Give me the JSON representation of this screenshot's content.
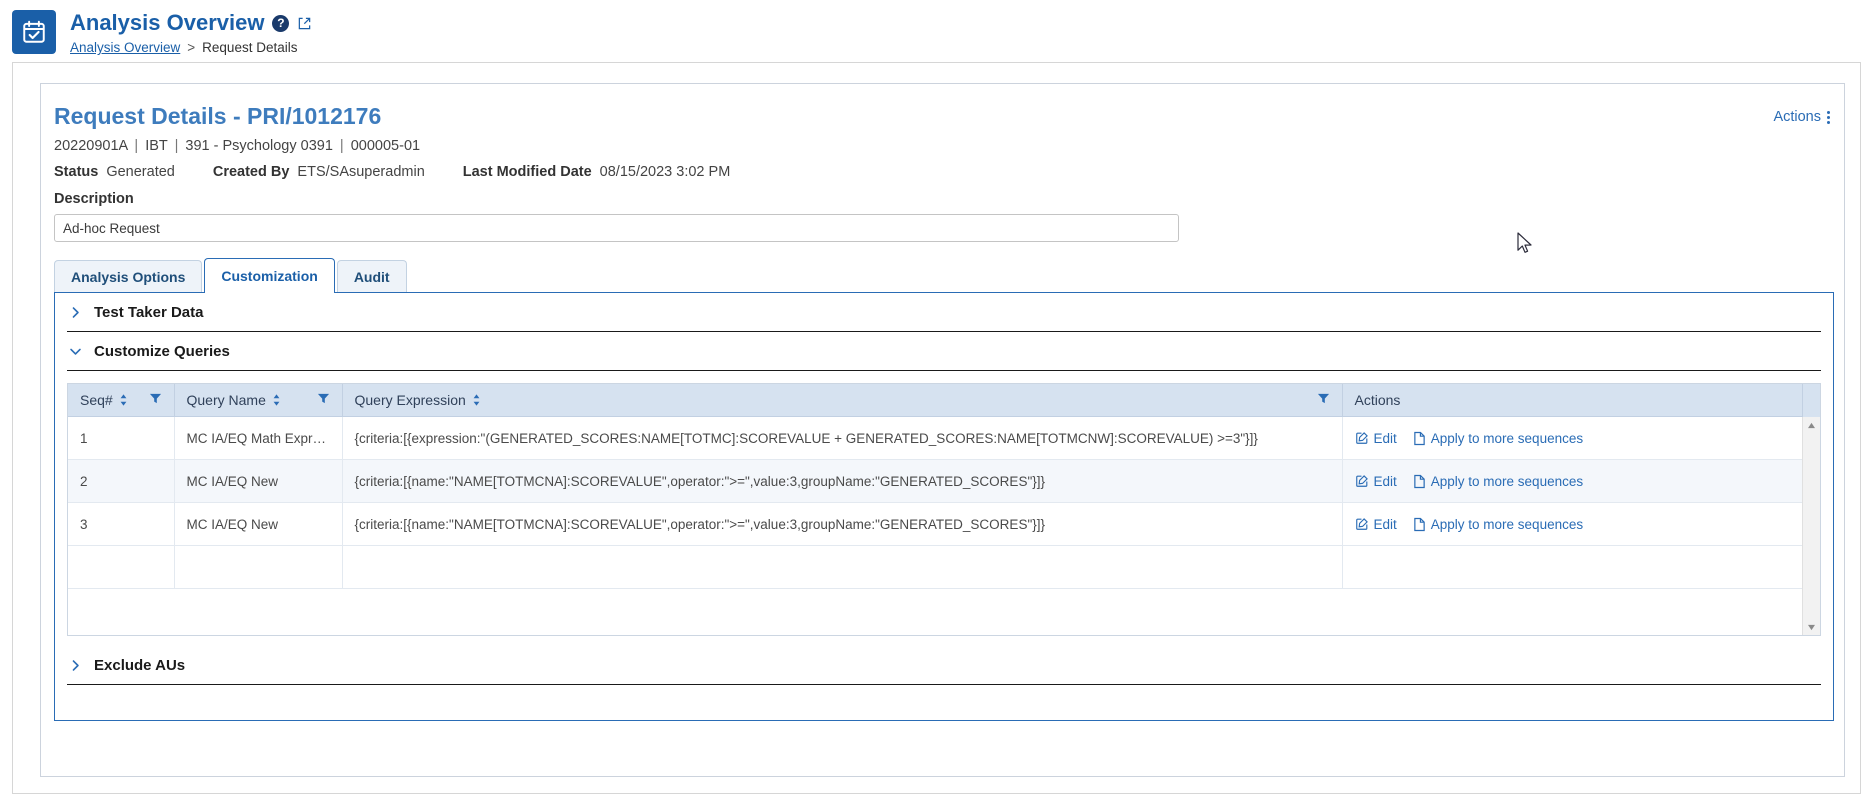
{
  "header": {
    "app_icon": "calendar-check-icon",
    "title": "Analysis Overview",
    "help_icon": "?",
    "external_link_icon": "external-link-icon",
    "breadcrumb": {
      "root": "Analysis Overview",
      "separator": ">",
      "current": "Request Details"
    }
  },
  "card": {
    "title": "Request Details - PRI/1012176",
    "actions_label": "Actions",
    "meta": {
      "form": "20220901A",
      "mode": "IBT",
      "subject": "391 - Psychology 0391",
      "sequence": "000005-01",
      "separator": "|"
    },
    "status": {
      "status_label": "Status",
      "status_value": "Generated",
      "created_by_label": "Created By",
      "created_by_value": "ETS/SAsuperadmin",
      "last_modified_label": "Last Modified Date",
      "last_modified_value": "08/15/2023 3:02 PM"
    },
    "description": {
      "label": "Description",
      "value": "Ad-hoc Request",
      "placeholder": "Description"
    }
  },
  "tabs": [
    {
      "label": "Analysis Options",
      "active": false
    },
    {
      "label": "Customization",
      "active": true
    },
    {
      "label": "Audit",
      "active": false
    }
  ],
  "sections": {
    "test_taker_data": {
      "label": "Test Taker Data",
      "expanded": false,
      "chevron": "chevron-right-icon"
    },
    "customize_queries": {
      "label": "Customize Queries",
      "expanded": true,
      "chevron": "chevron-down-icon"
    },
    "exclude_aus": {
      "label": "Exclude AUs",
      "expanded": false,
      "chevron": "chevron-right-icon"
    }
  },
  "table": {
    "columns": [
      {
        "key": "seq",
        "label": "Seq#",
        "sortable": true,
        "filterable": true
      },
      {
        "key": "query_name",
        "label": "Query Name",
        "sortable": true,
        "filterable": true
      },
      {
        "key": "query_expression",
        "label": "Query Expression",
        "sortable": true,
        "filterable": true
      },
      {
        "key": "actions",
        "label": "Actions",
        "sortable": false,
        "filterable": false
      }
    ],
    "rows": [
      {
        "seq": "1",
        "query_name": "MC IA/EQ Math Expression",
        "query_expression": "{criteria:[{expression:\"(GENERATED_SCORES:NAME[TOTMC]:SCOREVALUE + GENERATED_SCORES:NAME[TOTMCNW]:SCOREVALUE) >=3\"}]}",
        "edit_label": "Edit",
        "apply_label": "Apply to more sequences"
      },
      {
        "seq": "2",
        "query_name": "MC IA/EQ New",
        "query_expression": "{criteria:[{name:\"NAME[TOTMCNA]:SCOREVALUE\",operator:\">=\",value:3,groupName:\"GENERATED_SCORES\"}]}",
        "edit_label": "Edit",
        "apply_label": "Apply to more sequences"
      },
      {
        "seq": "3",
        "query_name": "MC IA/EQ New",
        "query_expression": "{criteria:[{name:\"NAME[TOTMCNA]:SCOREVALUE\",operator:\">=\",value:3,groupName:\"GENERATED_SCORES\"}]}",
        "edit_label": "Edit",
        "apply_label": "Apply to more sequences"
      }
    ]
  },
  "colors": {
    "brand_blue": "#1a5fa8",
    "link_blue": "#2a6cb5",
    "title_blue": "#3e7cbd",
    "table_header_bg": "#d6e2f0",
    "row_alt_bg": "#f4f7fb",
    "panel_border": "#2a6cb5"
  }
}
